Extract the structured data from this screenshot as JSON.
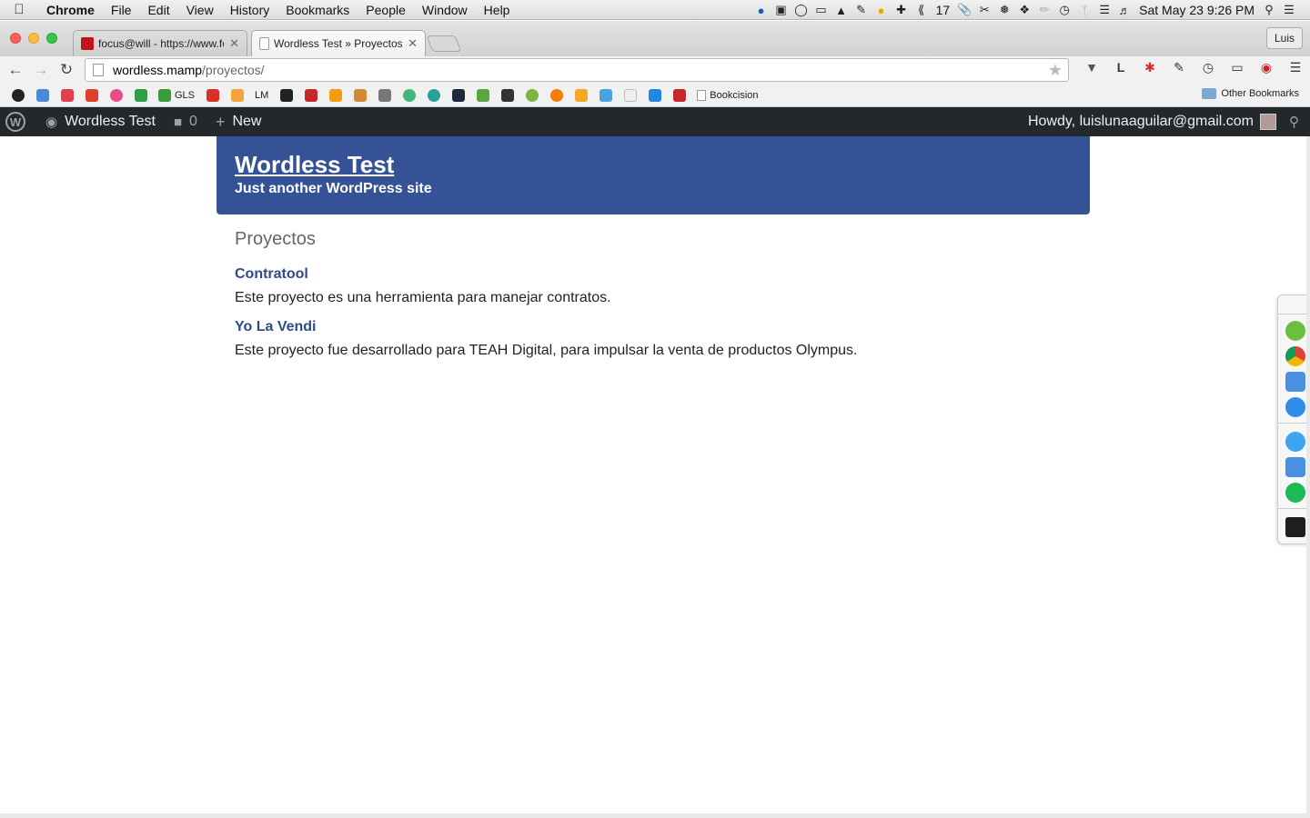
{
  "menubar": {
    "app_name": "Chrome",
    "items": [
      "File",
      "Edit",
      "View",
      "History",
      "Bookmarks",
      "People",
      "Window",
      "Help"
    ],
    "status_count": "17",
    "datetime": "Sat May 23  9:26 PM"
  },
  "tabs": [
    {
      "title": "focus@will - https://www.fo",
      "active": false
    },
    {
      "title": "Wordless Test » Proyectos",
      "active": true
    }
  ],
  "profile_name": "Luis",
  "address": {
    "host": "wordless.mamp",
    "path": "/proyectos/"
  },
  "bookmarks": {
    "gls_label": "GLS",
    "lm_label": "LM",
    "bookcision_label": "Bookcision",
    "other_label": "Other Bookmarks"
  },
  "wpbar": {
    "site_name": "Wordless Test",
    "comments_count": "0",
    "new_label": "New",
    "howdy": "Howdy, luislunaaguilar@gmail.com"
  },
  "site": {
    "title": "Wordless Test",
    "tagline": "Just another WordPress site",
    "page_heading": "Proyectos",
    "posts": [
      {
        "title": "Contratool",
        "excerpt": "Este proyecto es una herramienta para manejar contratos."
      },
      {
        "title": "Yo La Vendi",
        "excerpt": "Este proyecto fue desarrollado para TEAH Digital, para impulsar la venta de productos Olympus."
      }
    ]
  },
  "colors": {
    "header_bg": "#365296",
    "admin_bar_bg": "#23282d",
    "link": "#2f4a8a"
  }
}
